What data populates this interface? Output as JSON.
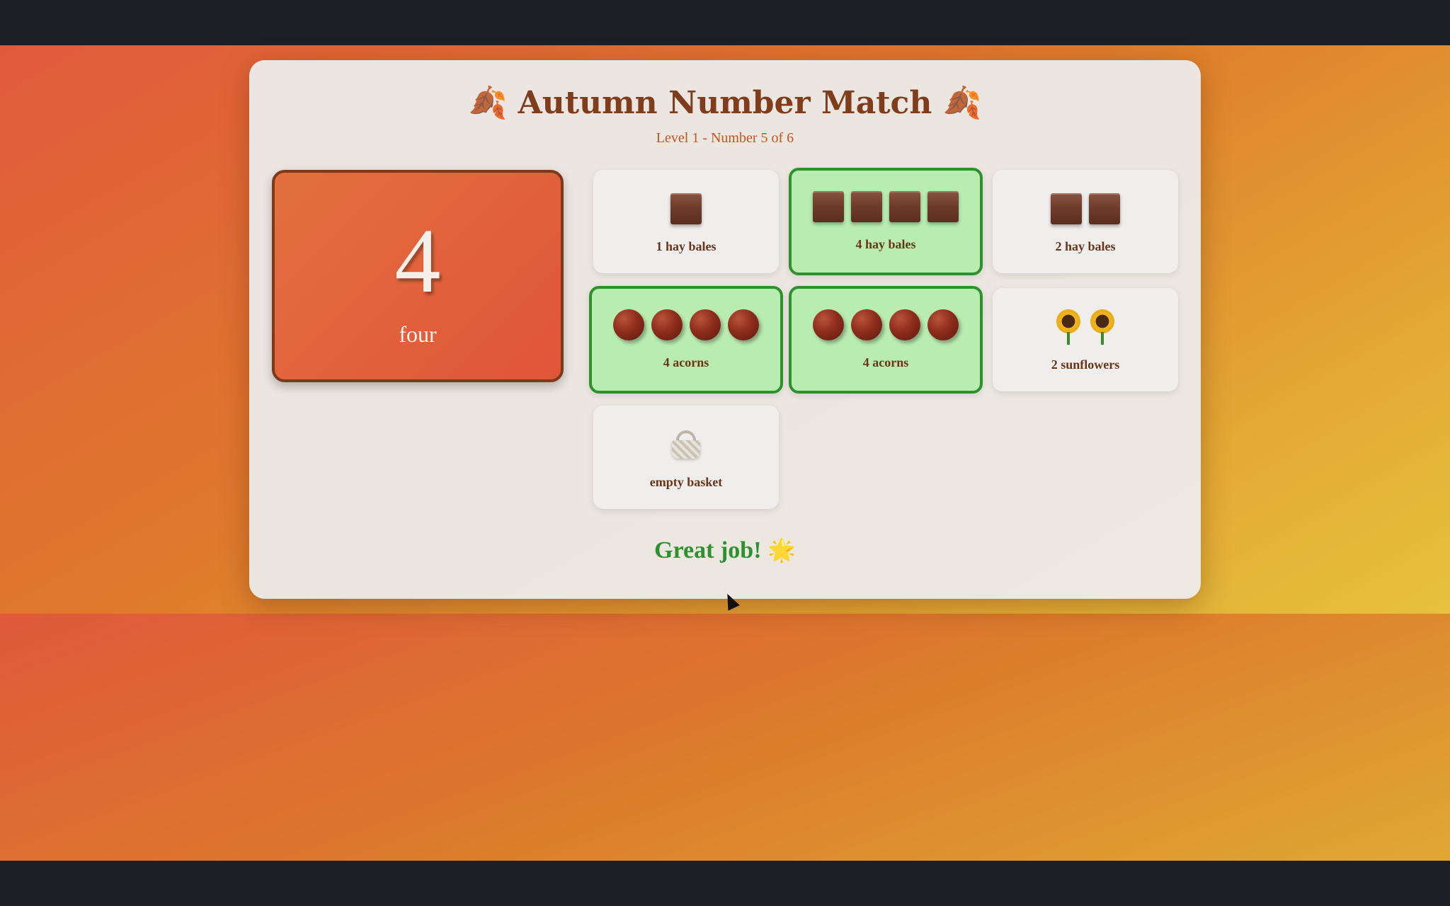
{
  "game": {
    "title": "Autumn Number Match",
    "title_icon": "falling-leaf-icon",
    "subtitle": "Level 1 - Number 5 of 6"
  },
  "target": {
    "number": "4",
    "word": "four"
  },
  "cards": [
    {
      "label": "1 hay bales",
      "icon": "hay-bale-icon",
      "count": 1,
      "matched": false
    },
    {
      "label": "4 hay bales",
      "icon": "hay-bale-icon",
      "count": 4,
      "matched": true
    },
    {
      "label": "2 hay bales",
      "icon": "hay-bale-icon",
      "count": 2,
      "matched": false
    },
    {
      "label": "4 acorns",
      "icon": "acorn-icon",
      "count": 4,
      "matched": true
    },
    {
      "label": "4 acorns",
      "icon": "acorn-icon",
      "count": 4,
      "matched": true
    },
    {
      "label": "2 sunflowers",
      "icon": "sunflower-icon",
      "count": 2,
      "matched": false
    },
    {
      "label": "empty basket",
      "icon": "basket-icon",
      "count": 1,
      "matched": false
    }
  ],
  "feedback": {
    "text": "Great job!",
    "icon": "star-icon"
  },
  "colors": {
    "matched_bg": "#b9ecb0",
    "matched_border": "#2f912e",
    "title": "#7f3d1c",
    "number_card": "#e05538"
  }
}
